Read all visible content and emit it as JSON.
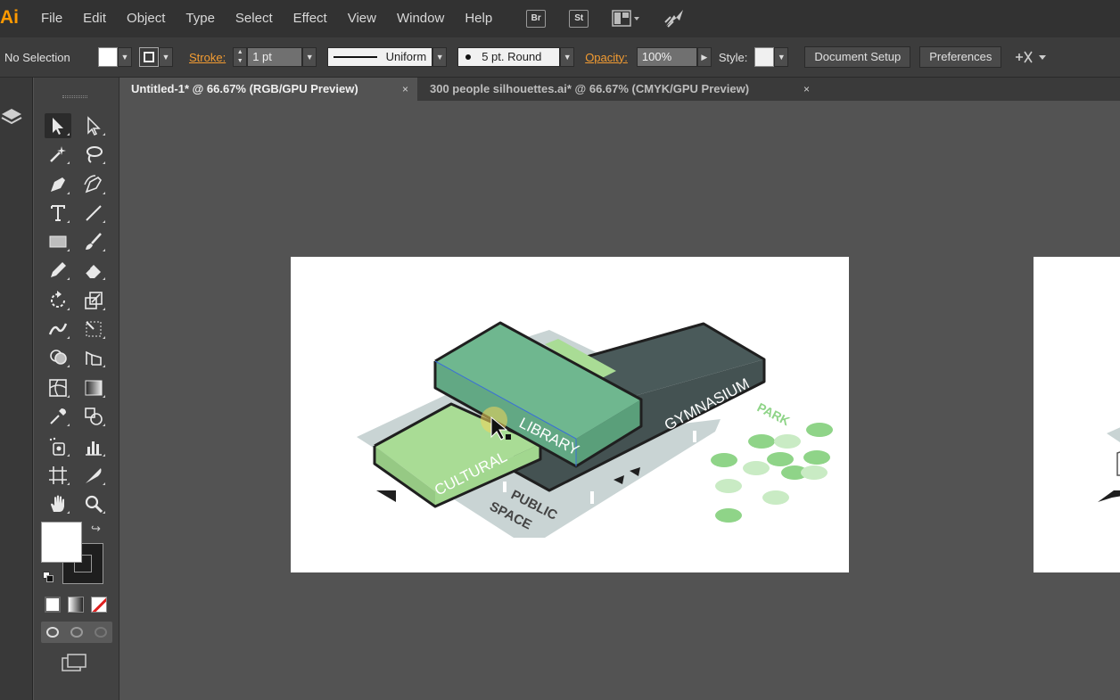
{
  "app": {
    "logo": "Ai"
  },
  "menu": [
    "File",
    "Edit",
    "Object",
    "Type",
    "Select",
    "Effect",
    "View",
    "Window",
    "Help"
  ],
  "menu_buttons": {
    "bridge": "Br",
    "stock": "St"
  },
  "control_bar": {
    "selection": "No Selection",
    "stroke_label": "Stroke:",
    "stroke_weight": "1 pt",
    "profile": "Uniform",
    "brush": "5 pt. Round",
    "opacity_label": "Opacity:",
    "opacity_value": "100%",
    "style_label": "Style:",
    "document_setup": "Document Setup",
    "preferences": "Preferences"
  },
  "tabs": [
    {
      "label": "Untitled-1* @ 66.67% (RGB/GPU Preview)",
      "close": "×"
    },
    {
      "label": "300 people silhouettes.ai* @ 66.67% (CMYK/GPU Preview)",
      "close": "×"
    }
  ],
  "artwork": {
    "labels": {
      "library": "LIBRARY",
      "gymnasium": "GYMNASIUM",
      "cultural": "CULTURAL",
      "public": "PUBLIC",
      "space": "SPACE",
      "park": "PARK"
    },
    "colors": {
      "library": "#6fb78f",
      "library_side": "#5a9f7a",
      "cultural": "#a9dc95",
      "gym": "#4a5a5a",
      "ground": "#c9d4d4",
      "park_dot": "#8fd488",
      "outline": "#1f1f1f"
    }
  },
  "colors": {
    "accent": "#f39c32",
    "menubar": "#323232",
    "panel": "#424242",
    "canvas": "#535353"
  }
}
